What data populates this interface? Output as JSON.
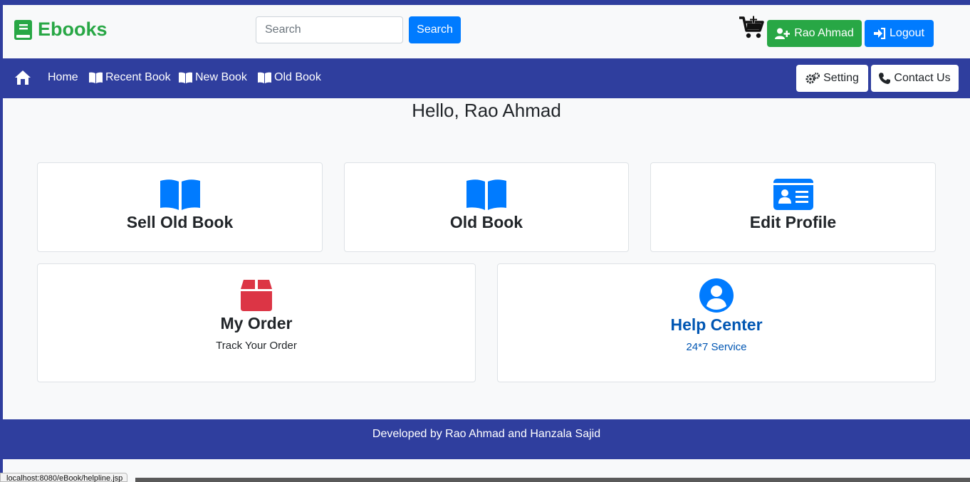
{
  "header": {
    "brand": "Ebooks",
    "search_placeholder": "Search",
    "search_button": "Search",
    "user_button": "Rao Ahmad",
    "logout_button": "Logout"
  },
  "navbar": {
    "items": [
      {
        "label": "Home"
      },
      {
        "label": "Recent Book"
      },
      {
        "label": "New Book"
      },
      {
        "label": "Old Book"
      }
    ],
    "setting": "Setting",
    "contact": "Contact Us"
  },
  "main": {
    "greeting": "Hello, Rao Ahmad",
    "cards": [
      {
        "title": "Sell Old Book",
        "icon": "book-open-icon"
      },
      {
        "title": "Old Book",
        "icon": "book-open-icon"
      },
      {
        "title": "Edit Profile",
        "icon": "id-card-icon"
      },
      {
        "title": "My Order",
        "subtitle": "Track Your Order",
        "icon": "box-icon"
      },
      {
        "title": "Help Center",
        "subtitle": "24*7 Service",
        "icon": "user-circle-icon"
      }
    ]
  },
  "footer": {
    "text": "Developed by Rao Ahmad and Hanzala Sajid"
  },
  "status_bar": {
    "url": "localhost:8080/eBook/helpline.jsp"
  },
  "colors": {
    "primary": "#007bff",
    "success": "#28a745",
    "danger": "#dc3545",
    "navbar": "#2f3e9e"
  }
}
